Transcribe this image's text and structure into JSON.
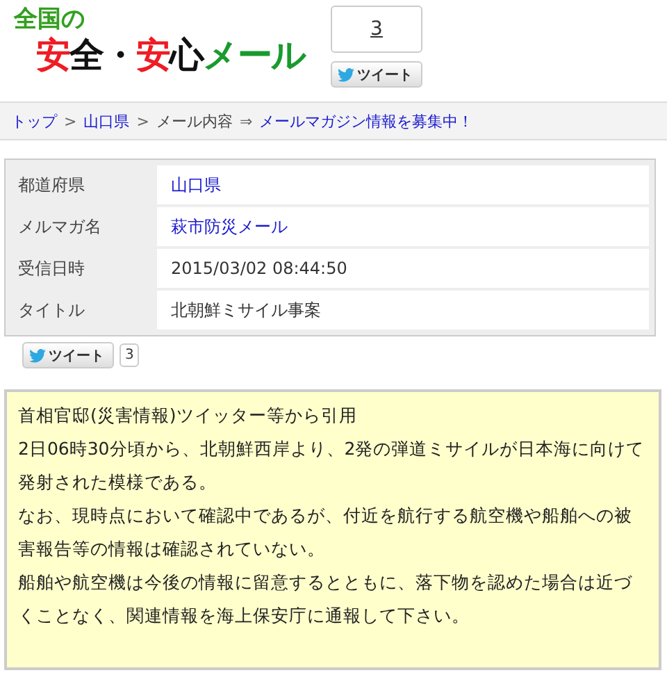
{
  "logo": {
    "top": [
      {
        "text": "全国の",
        "color": "#33a020"
      }
    ],
    "main": [
      {
        "text": "安",
        "color": "#ee1c24"
      },
      {
        "text": "全",
        "color": "#111111"
      },
      {
        "text": "・",
        "color": "#111111"
      },
      {
        "text": "安",
        "color": "#ee1c24"
      },
      {
        "text": "心",
        "color": "#111111"
      },
      {
        "text": "メール",
        "color": "#1a9a2e"
      }
    ]
  },
  "share_top": {
    "count": "3",
    "button": "ツイート"
  },
  "breadcrumb": [
    {
      "text": "トップ",
      "kind": "link"
    },
    {
      "text": ">",
      "kind": "separator"
    },
    {
      "text": "山口県",
      "kind": "link"
    },
    {
      "text": ">",
      "kind": "separator"
    },
    {
      "text": "メール内容",
      "kind": "plain"
    },
    {
      "text": "⇒",
      "kind": "separator"
    },
    {
      "text": "メールマガジン情報を募集中！",
      "kind": "link"
    }
  ],
  "details": [
    {
      "label": "都道府県",
      "value": "山口県",
      "link": true
    },
    {
      "label": "メルマガ名",
      "value": "萩市防災メール",
      "link": true
    },
    {
      "label": "受信日時",
      "value": "2015/03/02 08:44:50",
      "link": false
    },
    {
      "label": "タイトル",
      "value": "北朝鮮ミサイル事案",
      "link": false
    }
  ],
  "share_bottom": {
    "button": "ツイート",
    "count": "3"
  },
  "message": [
    "首相官邸(災害情報)ツイッター等から引用",
    "2日06時30分頃から、北朝鮮西岸より、2発の弾道ミサイルが日本海に向けて発射された模様である。",
    "なお、現時点において確認中であるが、付近を航行する航空機や船舶への被害報告等の情報は確認されていない。",
    "船舶や航空機は今後の情報に留意するとともに、落下物を認めた場合は近づくことなく、関連情報を海上保安庁に通報して下さい。"
  ]
}
